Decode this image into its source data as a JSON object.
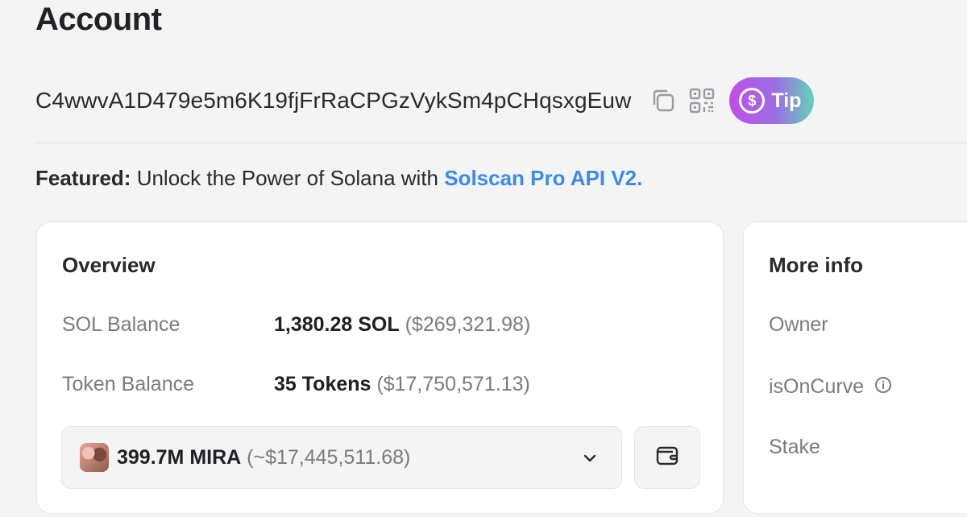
{
  "page": {
    "title": "Account"
  },
  "account": {
    "address": "C4wwvA1D479e5m6K19fjFrRaCPGzVykSm4pCHqsxgEuw",
    "tip_label": "Tip",
    "tip_icon_glyph": "$"
  },
  "featured": {
    "prefix": "Featured:",
    "text": " Unlock the Power of Solana with ",
    "link": "Solscan Pro API V2."
  },
  "overview": {
    "title": "Overview",
    "sol_balance": {
      "label": "SOL Balance",
      "amount": "1,380.28 SOL",
      "usd": "($269,321.98)"
    },
    "token_balance": {
      "label": "Token Balance",
      "count": "35 Tokens",
      "usd": "($17,750,571.13)"
    },
    "selected_token": {
      "amount": "399.7M MIRA",
      "usd": "(~$17,445,511.68)"
    }
  },
  "more_info": {
    "title": "More info",
    "rows": [
      "Owner",
      "isOnCurve",
      "Stake"
    ]
  },
  "icons": {
    "copy": "copy-icon",
    "qr": "qr-code-icon",
    "tip": "dollar-circle-icon",
    "chevron": "chevron-down-icon",
    "wallet": "wallet-icon",
    "info": "info-icon"
  },
  "colors": {
    "link": "#3b8beb",
    "tip_gradient": [
      "#c04ee8",
      "#9b6ee3",
      "#64d3b8"
    ]
  }
}
